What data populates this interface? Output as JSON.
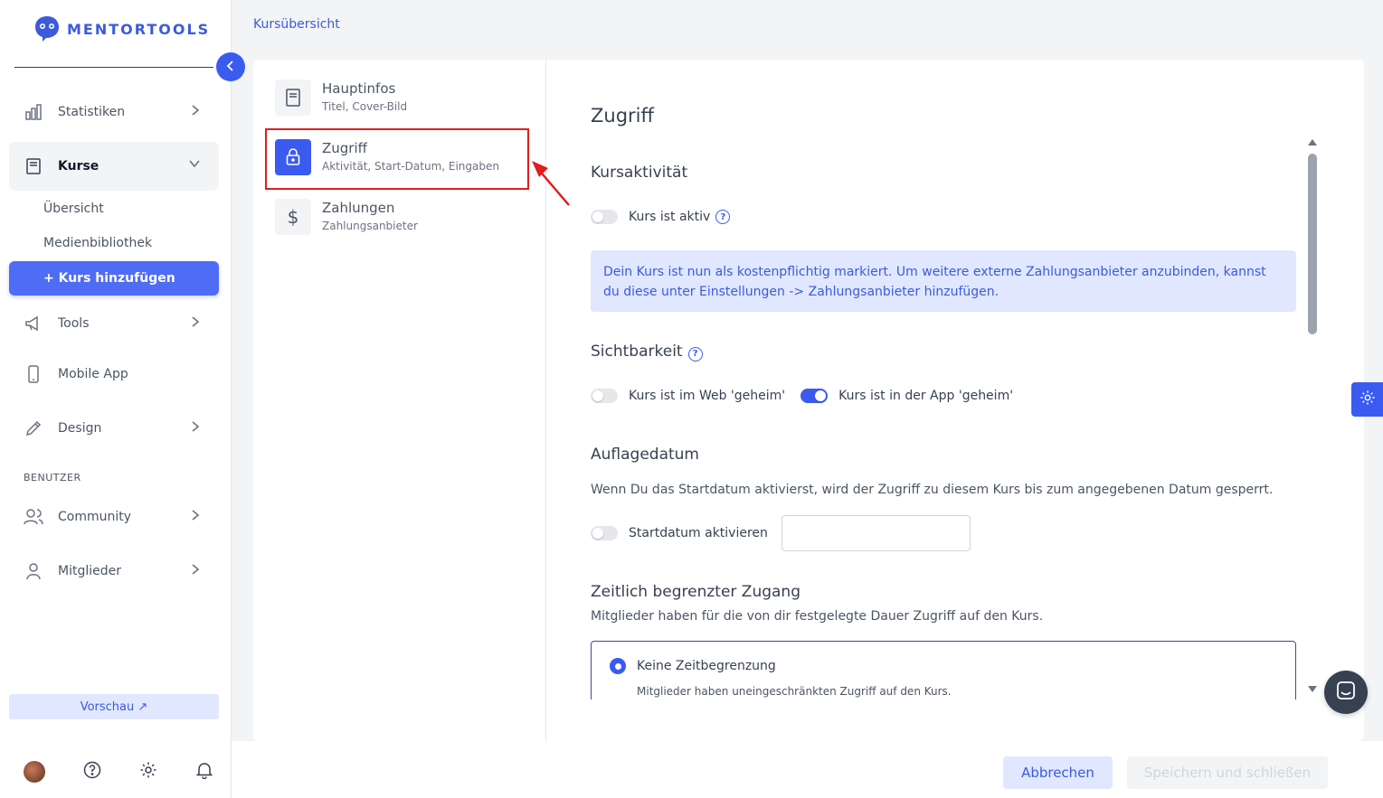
{
  "brand": {
    "name": "MENTORTOOLS"
  },
  "sidebar": {
    "items": [
      {
        "label": "Statistiken",
        "icon": "bar-chart-icon"
      },
      {
        "label": "Kurse",
        "icon": "book-icon"
      },
      {
        "label": "Tools",
        "icon": "megaphone-icon"
      },
      {
        "label": "Mobile App",
        "icon": "phone-icon"
      },
      {
        "label": "Design",
        "icon": "pencil-icon"
      },
      {
        "label": "Community",
        "icon": "users-icon"
      },
      {
        "label": "Mitglieder",
        "icon": "user-icon"
      }
    ],
    "sub_items": [
      "Übersicht",
      "Medienbibliothek"
    ],
    "add_course": "+ Kurs hinzufügen",
    "section_users": "BENUTZER",
    "preview": "Vorschau ↗"
  },
  "breadcrumb": "Kursübersicht",
  "steps": [
    {
      "title": "Hauptinfos",
      "desc": "Titel, Cover-Bild"
    },
    {
      "title": "Zugriff",
      "desc": "Aktivität, Start-Datum, Eingaben"
    },
    {
      "title": "Zahlungen",
      "desc": "Zahlungsanbieter"
    }
  ],
  "main": {
    "title": "Zugriff",
    "course_activity": {
      "heading": "Kursaktivität",
      "toggle_label": "Kurs ist aktiv",
      "active": false,
      "info": "Dein Kurs ist nun als kostenpflichtig markiert. Um weitere externe Zahlungsanbieter anzubinden, kannst du diese unter Einstellungen -> Zahlungsanbieter hinzufügen."
    },
    "visibility": {
      "heading": "Sichtbarkeit",
      "web_label": "Kurs ist im Web 'geheim'",
      "web_on": false,
      "app_label": "Kurs ist in der App 'geheim'",
      "app_on": true
    },
    "release_date": {
      "heading": "Auflagedatum",
      "description": "Wenn Du das Startdatum aktivierst, wird der Zugriff zu diesem Kurs bis zum angegebenen Datum gesperrt.",
      "toggle_label": "Startdatum aktivieren",
      "date_value": ""
    },
    "limited_access": {
      "heading": "Zeitlich begrenzter Zugang",
      "description": "Mitglieder haben für die von dir festgelegte Dauer Zugriff auf den Kurs.",
      "option_label": "Keine Zeitbegrenzung",
      "option_desc": "Mitglieder haben uneingeschränkten Zugriff auf den Kurs."
    }
  },
  "footer": {
    "cancel": "Abbrechen",
    "save": "Speichern und schließen"
  },
  "colors": {
    "accent": "#3b5bf0",
    "highlight": "#e11d1d",
    "info_bg": "#e0e7ff"
  }
}
